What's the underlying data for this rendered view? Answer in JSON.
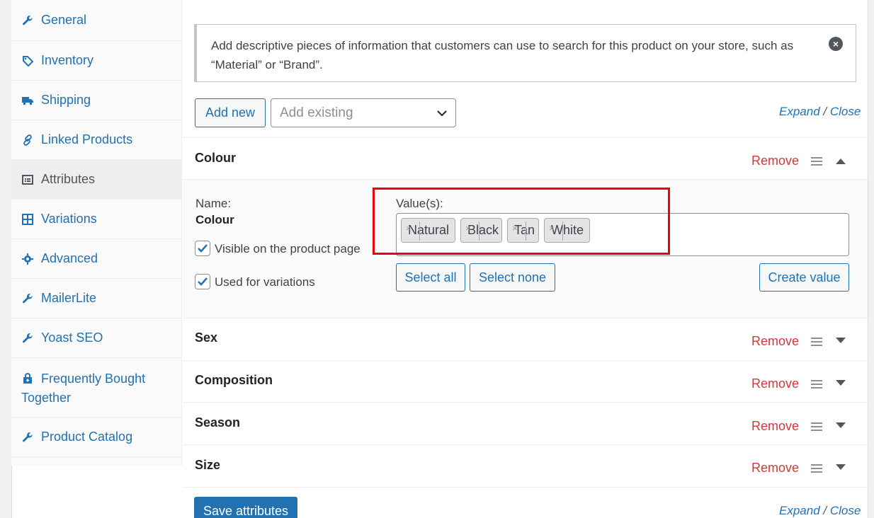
{
  "sidebar": {
    "items": [
      {
        "label": "General",
        "icon": "wrench-icon",
        "active": false
      },
      {
        "label": "Inventory",
        "icon": "tag-icon",
        "active": false
      },
      {
        "label": "Shipping",
        "icon": "truck-icon",
        "active": false
      },
      {
        "label": "Linked Products",
        "icon": "link-icon",
        "active": false
      },
      {
        "label": "Attributes",
        "icon": "list-icon",
        "active": true
      },
      {
        "label": "Variations",
        "icon": "grid-icon",
        "active": false
      },
      {
        "label": "Advanced",
        "icon": "gear-icon",
        "active": false
      },
      {
        "label": "MailerLite",
        "icon": "wrench-icon",
        "active": false
      },
      {
        "label": "Yoast SEO",
        "icon": "wrench-icon",
        "active": false
      },
      {
        "label": "Frequently Bought Together",
        "icon": "cart-icon",
        "active": false
      },
      {
        "label": "Product Catalog",
        "icon": "wrench-icon",
        "active": false
      }
    ]
  },
  "notice": {
    "text": "Add descriptive pieces of information that customers can use to search for this product on your store, such as “Material” or “Brand”."
  },
  "toolbar": {
    "add_new": "Add new",
    "add_existing_placeholder": "Add existing",
    "expand": "Expand",
    "separator": "/",
    "close": "Close"
  },
  "attributes": [
    {
      "name": "Colour",
      "remove": "Remove",
      "expanded": true
    },
    {
      "name": "Sex",
      "remove": "Remove",
      "expanded": false
    },
    {
      "name": "Composition",
      "remove": "Remove",
      "expanded": false
    },
    {
      "name": "Season",
      "remove": "Remove",
      "expanded": false
    },
    {
      "name": "Size",
      "remove": "Remove",
      "expanded": false
    }
  ],
  "colour_detail": {
    "name_label": "Name:",
    "name_value": "Colour",
    "visible_label": "Visible on the product page",
    "variations_label": "Used for variations",
    "values_label": "Value(s):",
    "values": [
      "Natural",
      "Black",
      "Tan",
      "White"
    ],
    "chip_remove": "×",
    "select_all": "Select all",
    "select_none": "Select none",
    "create_value": "Create value"
  },
  "footer": {
    "save": "Save attributes",
    "expand": "Expand",
    "separator": "/",
    "close": "Close"
  },
  "colors": {
    "accent": "#2271b1",
    "remove": "#d63638",
    "highlight": "#e8050d"
  }
}
